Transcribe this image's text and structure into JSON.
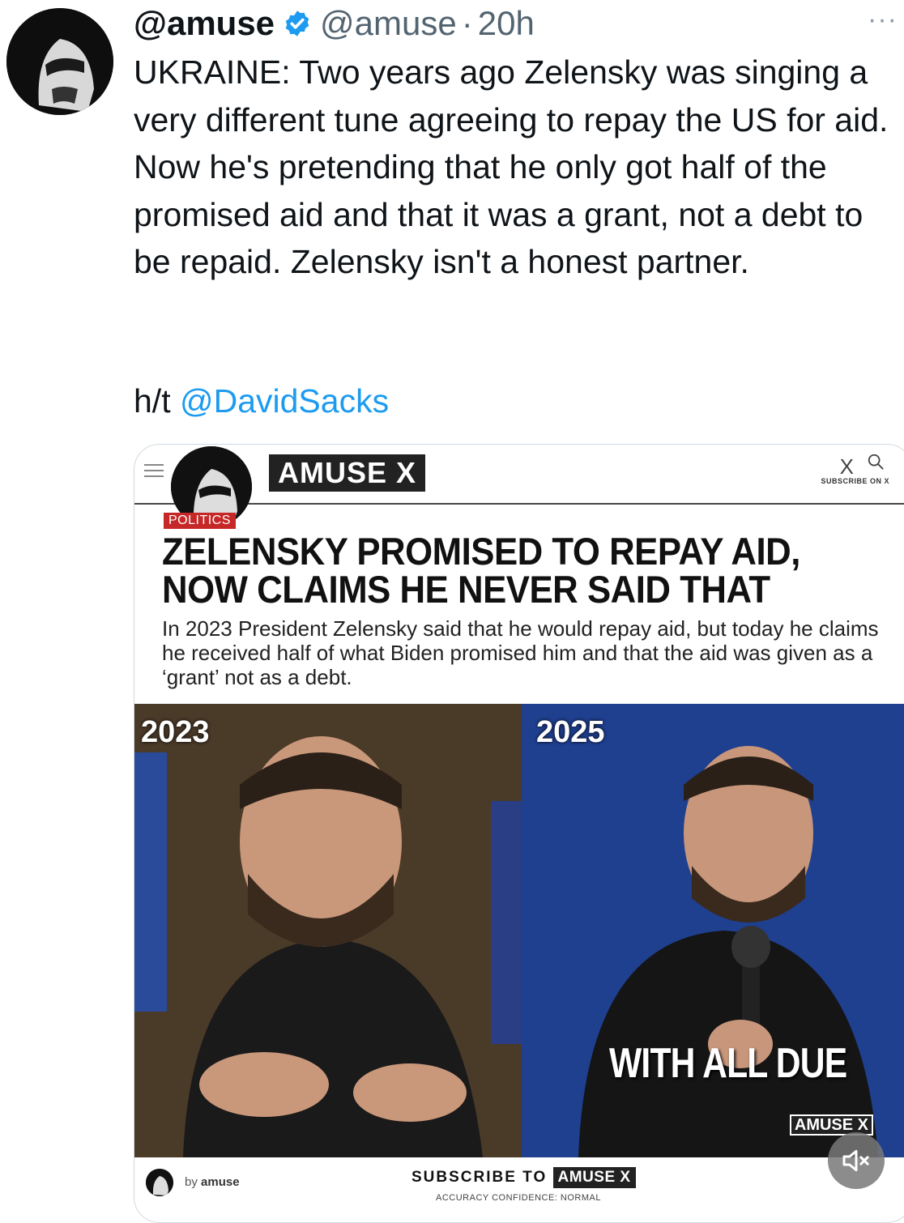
{
  "tweet": {
    "display_name": "@amuse",
    "handle": "@amuse",
    "separator": "·",
    "time": "20h",
    "more_label": "···",
    "text": "UKRAINE: Two years ago Zelensky was singing a very different tune agreeing to repay the US for aid. Now he's pretending that he only got half of the promised aid and that it was a grant, not a debt to be repaid. Zelensky isn't a honest partner.",
    "ht_prefix": "h/t ",
    "ht_mention": "@DavidSacks"
  },
  "media": {
    "site_logo": "AMUSE",
    "site_logo_suffix": "X",
    "site_x": "X",
    "subscribe_small": "SUBSCRIBE ON X",
    "tag": "POLITICS",
    "headline": "ZELENSKY PROMISED TO REPAY AID, NOW CLAIMS HE NEVER SAID THAT",
    "lead": "In 2023 President Zelensky said that he would repay aid, but today he claims he received half of what Biden promised him and that the aid was given as a ‘grant’ not as a debt.",
    "left_year": "2023",
    "right_year": "2025",
    "caption": "WITH ALL DUE",
    "watermark": "AMUSE X",
    "by_prefix": "by ",
    "by_name": "amuse",
    "subscribe_prefix": "SUBSCRIBE TO ",
    "subscribe_box": "AMUSE X",
    "accuracy": "ACCURACY CONFIDENCE: NORMAL"
  },
  "colors": {
    "link": "#1d9bf0",
    "verified": "#1d9bf0",
    "tag": "#c62828"
  },
  "icons": {
    "verified": "verified-badge-icon",
    "mute": "speaker-muted-icon",
    "more": "more-icon"
  }
}
